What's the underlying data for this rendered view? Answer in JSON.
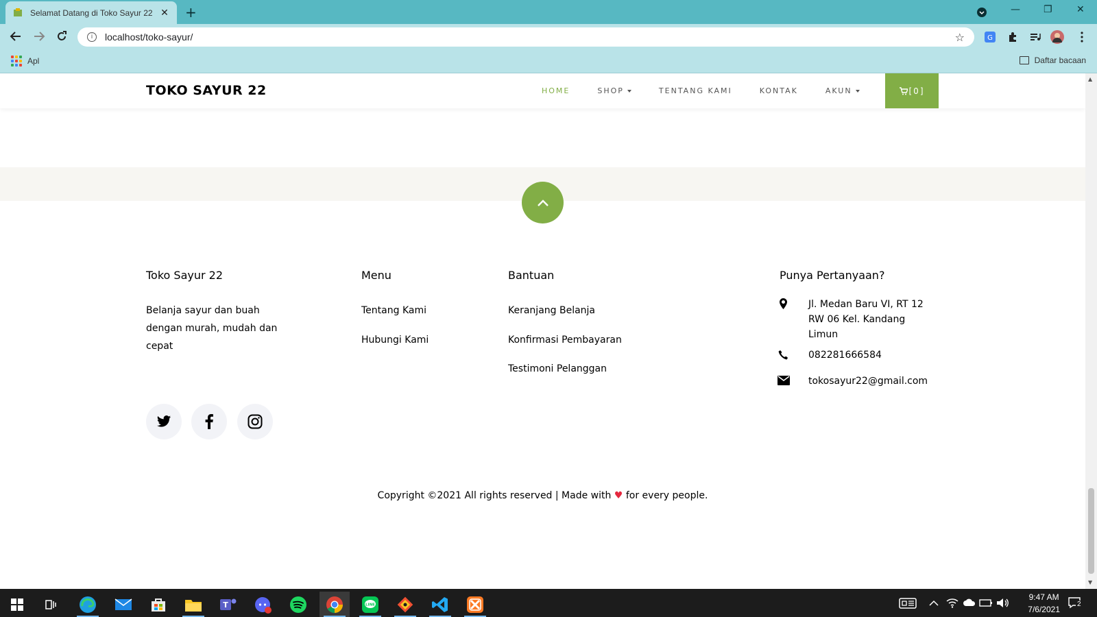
{
  "browser": {
    "tab_title": "Selamat Datang di Toko Sayur 22",
    "tab_close": "✕",
    "new_tab": "+",
    "url": "localhost/toko-sayur/",
    "bookmarks": {
      "apps_label": "Apl",
      "reading_list_label": "Daftar bacaan"
    },
    "window_controls": {
      "minimize": "—",
      "restore": "❐",
      "close": "✕"
    }
  },
  "site": {
    "brand": "TOKO SAYUR 22",
    "menu": [
      {
        "label": "HOME",
        "active": true
      },
      {
        "label": "SHOP",
        "dropdown": true
      },
      {
        "label": "TENTANG KAMI"
      },
      {
        "label": "KONTAK"
      },
      {
        "label": "AKUN",
        "dropdown": true
      }
    ],
    "cart_label": "[0]",
    "accent_color": "#82ae46"
  },
  "footer": {
    "about": {
      "title": "Toko Sayur 22",
      "text": "Belanja sayur dan buah dengan murah, mudah dan cepat"
    },
    "menu": {
      "title": "Menu",
      "links": [
        "Tentang Kami",
        "Hubungi Kami"
      ]
    },
    "help": {
      "title": "Bantuan",
      "links": [
        "Keranjang Belanja",
        "Konfirmasi Pembayaran",
        "Testimoni Pelanggan"
      ]
    },
    "contact": {
      "title": "Punya Pertanyaan?",
      "address": "Jl. Medan Baru VI, RT 12 RW 06 Kel. Kandang Limun",
      "phone": "082281666584",
      "email": "tokosayur22@gmail.com"
    },
    "social": [
      "twitter-icon",
      "facebook-icon",
      "instagram-icon"
    ],
    "copyright_before": "Copyright ©2021 All rights reserved | Made with",
    "copyright_heart": "♥",
    "copyright_after": "for every people."
  },
  "taskbar": {
    "time": "9:47 AM",
    "date": "7/6/2021",
    "notification_count": "2",
    "apps": [
      "edge-icon",
      "mail-icon",
      "store-icon",
      "file-explorer-icon",
      "teams-icon",
      "discord-icon",
      "spotify-icon",
      "chrome-icon",
      "line-icon",
      "git-icon",
      "vscode-icon",
      "xampp-icon"
    ]
  }
}
